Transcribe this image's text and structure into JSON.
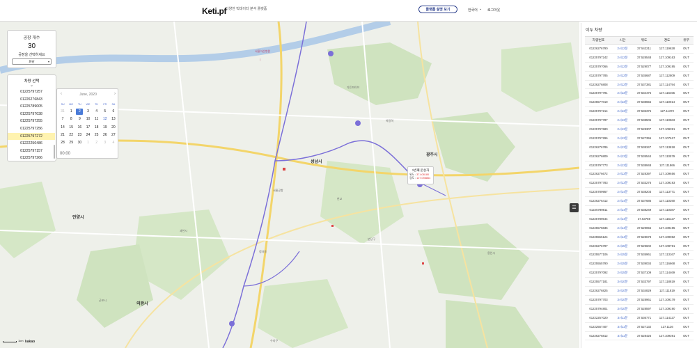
{
  "header": {
    "logo": "Keti.pf",
    "tagline": "다양한 빅데이터 분석 플랫폼",
    "guide_button": "플랫폼 설명 보기",
    "language": "한국어",
    "logout": "로그아웃"
  },
  "facility": {
    "title": "공장 개수",
    "count": "30",
    "select_label": "공장을 선택하세요",
    "selected": "화남"
  },
  "vehicle": {
    "title": "차량 선택",
    "items": [
      "01225797257",
      "01226276843",
      "01225789005",
      "01225797038",
      "01225797255",
      "01225797256",
      "01225797272",
      "01222250486",
      "01225797157",
      "01225797266"
    ],
    "selected_index": 6
  },
  "calendar": {
    "month_label": "June, 2020",
    "dow": [
      "SU",
      "MO",
      "TU",
      "WE",
      "TH",
      "FR",
      "SA"
    ],
    "weeks": [
      [
        "31",
        "1",
        "2",
        "3",
        "4",
        "5",
        "6"
      ],
      [
        "7",
        "8",
        "9",
        "10",
        "11",
        "12",
        "13"
      ],
      [
        "14",
        "15",
        "16",
        "17",
        "18",
        "19",
        "20"
      ],
      [
        "21",
        "22",
        "23",
        "24",
        "25",
        "26",
        "27"
      ],
      [
        "28",
        "29",
        "30",
        "1",
        "2",
        "3",
        "4"
      ]
    ],
    "selected_day": "2",
    "time": "00:00"
  },
  "tooltip": {
    "title": "1번째 운송차",
    "lat_label": "위도 : ",
    "lat_value": "37.408180",
    "lng_label": "경도 : ",
    "lng_value": "127.098864"
  },
  "map_labels": {
    "kakao": "kakao",
    "scale": "1km"
  },
  "right_panel": {
    "title": "이두 차량",
    "columns": [
      "차량번호",
      "시간",
      "위도",
      "경도",
      "유무"
    ],
    "rows": [
      [
        "01226276790",
        "2시12분",
        "37.542211",
        "127.119628",
        "OUT"
      ],
      [
        "01225797242",
        "2시12분",
        "37.528548",
        "127.109163",
        "OUT"
      ],
      [
        "01225797066",
        "2시12분",
        "37.529077",
        "127.109195",
        "OUT"
      ],
      [
        "01225797785",
        "2시12분",
        "37.535687",
        "127.112809",
        "OUT"
      ],
      [
        "01226276808",
        "2시12분",
        "37.537381",
        "127.114794",
        "OUT"
      ],
      [
        "01225797791",
        "2시13분",
        "37.534476",
        "127.116455",
        "OUT"
      ],
      [
        "01225577019",
        "2시13분",
        "37.538655",
        "127.110014",
        "OUT"
      ],
      [
        "01225797214",
        "2시13분",
        "37.536376",
        "127.11372",
        "OUT"
      ],
      [
        "01225797787",
        "2시13분",
        "37.538505",
        "127.110563",
        "OUT"
      ],
      [
        "01225797680",
        "2시13분",
        "37.528307",
        "127.109391",
        "OUT"
      ],
      [
        "01225797296",
        "2시13분",
        "37.527355",
        "127.107617",
        "OUT"
      ],
      [
        "01226276786",
        "2시13분",
        "37.538347",
        "127.113818",
        "OUT"
      ],
      [
        "01226276809",
        "2시13분",
        "37.535544",
        "127.110579",
        "OUT"
      ],
      [
        "01225797773",
        "2시13분",
        "37.538948",
        "127.111866",
        "OUT"
      ],
      [
        "01226276672",
        "2시13분",
        "37.528397",
        "127.109656",
        "OUT"
      ],
      [
        "01225797783",
        "2시13분",
        "37.533276",
        "127.109193",
        "OUT"
      ],
      [
        "01225789957",
        "2시14분",
        "37.538203",
        "127.113771",
        "OUT"
      ],
      [
        "01226276412",
        "2시14분",
        "37.537686",
        "127.110290",
        "OUT"
      ],
      [
        "01225789811",
        "2시14분",
        "37.538249",
        "127.110387",
        "OUT"
      ],
      [
        "01225789644",
        "2시14분",
        "37.53788",
        "127.115127",
        "OUT"
      ],
      [
        "01225575836",
        "2시14분",
        "37.529056",
        "127.109195",
        "OUT"
      ],
      [
        "01225555124",
        "2시14분",
        "37.528678",
        "127.109082",
        "OUT"
      ],
      [
        "01226276797",
        "2시15분",
        "37.529602",
        "127.109781",
        "OUT"
      ],
      [
        "01225577106",
        "2시15분",
        "37.535961",
        "127.113167",
        "OUT"
      ],
      [
        "01225555790",
        "2시15분",
        "37.539034",
        "127.116668",
        "OUT"
      ],
      [
        "01225797092",
        "2시15분",
        "37.537109",
        "127.114469",
        "OUT"
      ],
      [
        "01225577181",
        "3시10분",
        "37.533797",
        "127.118819",
        "OUT"
      ],
      [
        "01226276825",
        "3시10분",
        "37.534829",
        "127.111819",
        "OUT"
      ],
      [
        "01225797703",
        "3시10분",
        "37.528961",
        "127.109179",
        "OUT"
      ],
      [
        "01225794801",
        "3시10분",
        "37.528597",
        "127.109190",
        "OUT"
      ],
      [
        "01222257020",
        "3시11분",
        "37.536771",
        "127.114127",
        "OUT"
      ],
      [
        "01222557407",
        "3시11분",
        "37.527132",
        "127.1126",
        "OUT"
      ],
      [
        "01226276812",
        "3시11분",
        "37.528426",
        "127.109391",
        "OUT"
      ]
    ]
  }
}
